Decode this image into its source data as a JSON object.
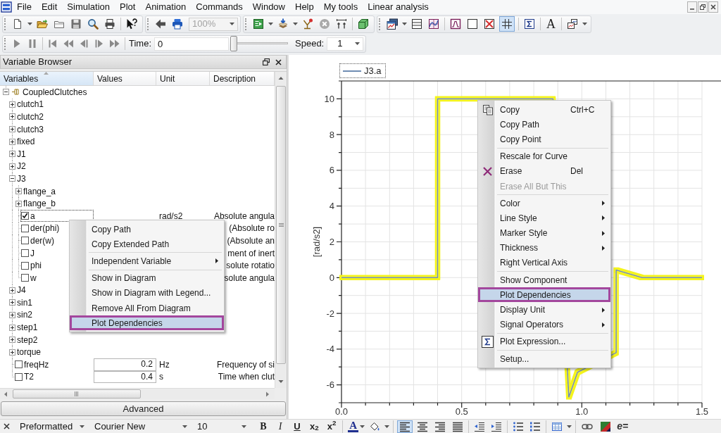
{
  "menu_bar": {
    "items": [
      "File",
      "Edit",
      "Simulation",
      "Plot",
      "Animation",
      "Commands",
      "Window",
      "Help",
      "My tools",
      "Linear analysis"
    ]
  },
  "toolbar": {
    "zoom": {
      "value": "100%",
      "disabled": true
    },
    "grid_toggle": {
      "on": true
    },
    "text_tool": "A"
  },
  "animation_bar": {
    "time_label": "Time:",
    "time_value": "0",
    "time_slider": {
      "level": 0
    },
    "speed_label": "Speed:",
    "speed_value": "1"
  },
  "variable_browser": {
    "title": "Variable Browser",
    "columns": [
      {
        "label": "Variables",
        "sorted": true
      },
      {
        "label": "Values",
        "sorted": false
      },
      {
        "label": "Unit",
        "sorted": false
      },
      {
        "label": "Description",
        "sorted": false
      }
    ],
    "tree": [
      {
        "kind": "model",
        "label": "CoupledClutches",
        "expanded": true,
        "selected": false,
        "children": [
          {
            "kind": "group",
            "label": "clutch1",
            "expanded": false,
            "selected": false
          },
          {
            "kind": "group",
            "label": "clutch2",
            "expanded": false,
            "selected": false
          },
          {
            "kind": "group",
            "label": "clutch3",
            "expanded": false,
            "selected": false
          },
          {
            "kind": "group",
            "label": "fixed",
            "expanded": false,
            "selected": false
          },
          {
            "kind": "group",
            "label": "J1",
            "expanded": false,
            "selected": false
          },
          {
            "kind": "group",
            "label": "J2",
            "expanded": false,
            "selected": false
          },
          {
            "kind": "group",
            "label": "J3",
            "expanded": true,
            "selected": false,
            "children": [
              {
                "kind": "group",
                "label": "flange_a",
                "expanded": false,
                "selected": false
              },
              {
                "kind": "group",
                "label": "flange_b",
                "expanded": false,
                "selected": false
              },
              {
                "kind": "variable",
                "label": "a",
                "checked": true,
                "selected": true,
                "unit": "rad/s2",
                "description": "Absolute angula"
              },
              {
                "kind": "variable",
                "label": "der(phi)",
                "checked": false,
                "selected": false,
                "description": "(Absolute ro"
              },
              {
                "kind": "variable",
                "label": "der(w)",
                "checked": false,
                "selected": false,
                "description": "(Absolute an"
              },
              {
                "kind": "variable",
                "label": "J",
                "checked": false,
                "selected": false,
                "description": "ment of inert"
              },
              {
                "kind": "variable",
                "label": "phi",
                "checked": false,
                "selected": false,
                "description": "solute rotatio"
              },
              {
                "kind": "variable",
                "label": "w",
                "checked": false,
                "selected": false,
                "description": "solute angula"
              }
            ]
          },
          {
            "kind": "group",
            "label": "J4",
            "expanded": false,
            "selected": false
          },
          {
            "kind": "group",
            "label": "sin1",
            "expanded": false,
            "selected": false
          },
          {
            "kind": "group",
            "label": "sin2",
            "expanded": false,
            "selected": false
          },
          {
            "kind": "group",
            "label": "step1",
            "expanded": false,
            "selected": false
          },
          {
            "kind": "group",
            "label": "step2",
            "expanded": false,
            "selected": false
          },
          {
            "kind": "group",
            "label": "torque",
            "expanded": false,
            "selected": false
          },
          {
            "kind": "variable",
            "label": "freqHz",
            "checked": false,
            "selected": false,
            "value": "0.2",
            "unit": "Hz",
            "description": "Frequency of si"
          },
          {
            "kind": "variable",
            "label": "T2",
            "checked": false,
            "selected": false,
            "value": "0.4",
            "unit": "s",
            "description": "Time when clut"
          }
        ]
      }
    ],
    "context_menu": {
      "groups": [
        {
          "items": [
            {
              "label": "Copy Path",
              "submenu": false,
              "selected": false
            },
            {
              "label": "Copy Extended Path",
              "submenu": false,
              "selected": false
            }
          ]
        },
        {
          "items": [
            {
              "label": "Independent Variable",
              "submenu": true,
              "selected": false
            }
          ]
        },
        {
          "items": [
            {
              "label": "Show in Diagram",
              "submenu": false,
              "selected": false
            },
            {
              "label": "Show in Diagram with Legend...",
              "submenu": false,
              "selected": false
            },
            {
              "label": "Remove All From Diagram",
              "submenu": false,
              "selected": false
            },
            {
              "label": "Plot Dependencies",
              "submenu": false,
              "selected": true
            }
          ]
        }
      ]
    },
    "advanced_button": "Advanced"
  },
  "plot": {
    "curve_selected": true,
    "chart_data": {
      "type": "line",
      "ylabel": "[rad/s2]",
      "x": [
        0,
        0.4,
        0.4,
        0.88,
        0.946,
        0.982,
        1.143,
        1.143,
        1.25,
        1.5
      ],
      "series": [
        {
          "name": "J3.a",
          "color": "#6f8db3",
          "values": [
            0,
            0,
            10,
            10,
            -6.68,
            -5.3,
            -4.2,
            0.43,
            0,
            0
          ]
        }
      ],
      "xlim": [
        0,
        1.5
      ],
      "ylim": [
        -7,
        11
      ],
      "xticks": [
        {
          "value": 0,
          "label": "0.0"
        },
        {
          "value": 0.5,
          "label": "0.5"
        },
        {
          "value": 1,
          "label": "1.0"
        },
        {
          "value": 1.5,
          "label": "1.5"
        }
      ],
      "yticks": [
        -6,
        -4,
        -2,
        0,
        2,
        4,
        6,
        8,
        10
      ],
      "grid": true
    },
    "context_menu": {
      "groups": [
        {
          "items": [
            {
              "kind": "copy",
              "label": "Copy",
              "shortcut": "Ctrl+C",
              "submenu": false,
              "disabled": false,
              "selected": false
            },
            {
              "kind": "plain",
              "label": "Copy Path",
              "submenu": false,
              "disabled": false,
              "selected": false
            },
            {
              "kind": "plain",
              "label": "Copy Point",
              "submenu": false,
              "disabled": false,
              "selected": false
            }
          ]
        },
        {
          "items": [
            {
              "kind": "plain",
              "label": "Rescale for Curve",
              "submenu": false,
              "disabled": false,
              "selected": false
            },
            {
              "kind": "erase",
              "label": "Erase",
              "shortcut": "Del",
              "submenu": false,
              "disabled": false,
              "selected": false
            },
            {
              "kind": "plain",
              "label": "Erase All But This",
              "submenu": false,
              "disabled": true,
              "selected": false
            }
          ]
        },
        {
          "items": [
            {
              "kind": "plain",
              "label": "Color",
              "submenu": true,
              "disabled": false,
              "selected": false
            },
            {
              "kind": "plain",
              "label": "Line Style",
              "submenu": true,
              "disabled": false,
              "selected": false
            },
            {
              "kind": "plain",
              "label": "Marker Style",
              "submenu": true,
              "disabled": false,
              "selected": false
            },
            {
              "kind": "plain",
              "label": "Thickness",
              "submenu": true,
              "disabled": false,
              "selected": false
            },
            {
              "kind": "plain",
              "label": "Right Vertical Axis",
              "submenu": false,
              "disabled": false,
              "selected": false
            }
          ]
        },
        {
          "items": [
            {
              "kind": "plain",
              "label": "Show Component",
              "submenu": false,
              "disabled": false,
              "selected": false
            },
            {
              "kind": "plain",
              "label": "Plot Dependencies",
              "submenu": false,
              "disabled": false,
              "selected": true
            },
            {
              "kind": "plain",
              "label": "Display Unit",
              "submenu": true,
              "disabled": false,
              "selected": false
            },
            {
              "kind": "plain",
              "label": "Signal Operators",
              "submenu": true,
              "disabled": false,
              "selected": false
            }
          ]
        },
        {
          "items": [
            {
              "kind": "expression",
              "label": "Plot Expression...",
              "submenu": false,
              "disabled": false,
              "selected": false
            }
          ]
        },
        {
          "items": [
            {
              "kind": "plain",
              "label": "Setup...",
              "submenu": false,
              "disabled": false,
              "selected": false
            }
          ]
        }
      ]
    }
  },
  "format_toolbar": {
    "paragraph_style": "Preformatted",
    "font": "Courier New",
    "size": "10",
    "text_styles": [
      {
        "kind": "bold",
        "label": "B"
      },
      {
        "kind": "italic",
        "label": "I"
      },
      {
        "kind": "underline",
        "label": "U"
      },
      {
        "kind": "subscript",
        "label": "x$_{2}$"
      },
      {
        "kind": "superscript",
        "label": "x$^{2}$"
      }
    ],
    "font_color_label": "A",
    "alignments": [
      {
        "kind": "left",
        "selected": true
      },
      {
        "kind": "center",
        "selected": false
      },
      {
        "kind": "right",
        "selected": false
      },
      {
        "kind": "justify",
        "selected": false
      }
    ],
    "equation_label": "e="
  }
}
